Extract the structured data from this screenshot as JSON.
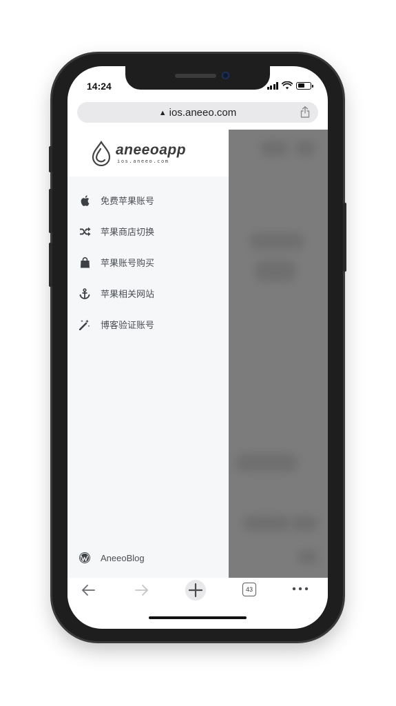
{
  "status_bar": {
    "time": "14:24"
  },
  "url_bar": {
    "warning_icon": "warning-triangle-icon",
    "url": "ios.aneeo.com",
    "share_icon": "share-icon"
  },
  "logo": {
    "name": "aneeoapp",
    "subtitle": "ios.aneeo.com"
  },
  "menu": {
    "items": [
      {
        "icon": "apple-icon",
        "label": "免费苹果账号"
      },
      {
        "icon": "shuffle-icon",
        "label": "苹果商店切换"
      },
      {
        "icon": "shopping-bag-icon",
        "label": "苹果账号购买"
      },
      {
        "icon": "anchor-icon",
        "label": "苹果相关网站"
      },
      {
        "icon": "magic-wand-icon",
        "label": "博客验证账号"
      }
    ],
    "footer": {
      "icon": "wordpress-icon",
      "label": "AneeoBlog"
    }
  },
  "toolbar": {
    "back_icon": "arrow-left-icon",
    "forward_icon": "arrow-right-icon",
    "new_tab_icon": "plus-icon",
    "tab_count": "43",
    "more_icon": "more-dots-icon"
  },
  "colors": {
    "drawer_bg": "#f6f7f8",
    "overlay": "#7c7c7c",
    "text": "#4a4d52"
  }
}
